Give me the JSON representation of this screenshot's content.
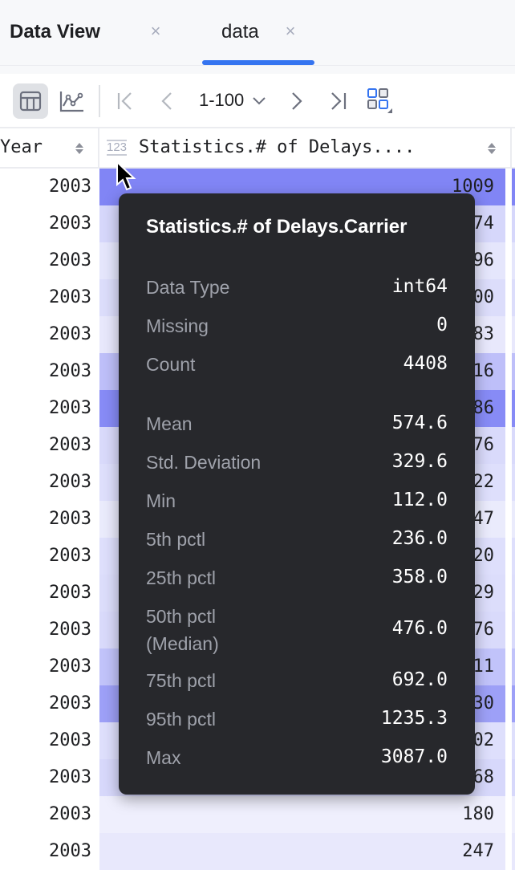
{
  "tabs": {
    "panel_title": "Data View",
    "items": [
      {
        "label": "data",
        "active": true
      }
    ],
    "accent_color": "#3574f0"
  },
  "toolbar": {
    "table_view": "table-icon",
    "chart_view": "line-chart-icon",
    "first_page": "first-page-icon",
    "prev_page": "previous-page-icon",
    "page_range": "1-100",
    "next_page": "next-page-icon",
    "last_page": "last-page-icon",
    "columns_layout": "grid-layout-icon"
  },
  "table": {
    "columns": [
      {
        "name": "Year"
      },
      {
        "name": "Statistics.# of Delays....",
        "type_badge": "123"
      }
    ],
    "rows": [
      {
        "year": "2003",
        "value": "1009",
        "heat": 0.95
      },
      {
        "year": "2003",
        "value": "374",
        "heat": 0.25
      },
      {
        "year": "2003",
        "value": "296",
        "heat": 0.12
      },
      {
        "year": "2003",
        "value": "300",
        "heat": 0.2
      },
      {
        "year": "2003",
        "value": "283",
        "heat": 0.1
      },
      {
        "year": "2003",
        "value": "516",
        "heat": 0.45
      },
      {
        "year": "2003",
        "value": "986",
        "heat": 0.9
      },
      {
        "year": "2003",
        "value": "376",
        "heat": 0.22
      },
      {
        "year": "2003",
        "value": "322",
        "heat": 0.18
      },
      {
        "year": "2003",
        "value": "247",
        "heat": 0.08
      },
      {
        "year": "2003",
        "value": "320",
        "heat": 0.18
      },
      {
        "year": "2003",
        "value": "329",
        "heat": 0.2
      },
      {
        "year": "2003",
        "value": "376",
        "heat": 0.22
      },
      {
        "year": "2003",
        "value": "511",
        "heat": 0.42
      },
      {
        "year": "2003",
        "value": "830",
        "heat": 0.72
      },
      {
        "year": "2003",
        "value": "302",
        "heat": 0.18
      },
      {
        "year": "2003",
        "value": "368",
        "heat": 0.24
      },
      {
        "year": "2003",
        "value": "180",
        "heat": 0.04
      },
      {
        "year": "2003",
        "value": "247",
        "heat": 0.1
      }
    ],
    "heat_color": "#7b7ff5"
  },
  "tooltip": {
    "title": "Statistics.# of Delays.Carrier",
    "stats": [
      {
        "label": "Data Type",
        "value": "int64"
      },
      {
        "label": "Missing",
        "value": "0"
      },
      {
        "label": "Count",
        "value": "4408"
      },
      {
        "label": "Mean",
        "value": "574.6"
      },
      {
        "label": "Std. Deviation",
        "value": "329.6"
      },
      {
        "label": "Min",
        "value": "112.0"
      },
      {
        "label": "5th pctl",
        "value": "236.0"
      },
      {
        "label": "25th pctl",
        "value": "358.0"
      },
      {
        "label": "50th pctl\n(Median)",
        "value": "476.0"
      },
      {
        "label": "75th pctl",
        "value": "692.0"
      },
      {
        "label": "95th pctl",
        "value": "1235.3"
      },
      {
        "label": "Max",
        "value": "3087.0"
      }
    ]
  }
}
